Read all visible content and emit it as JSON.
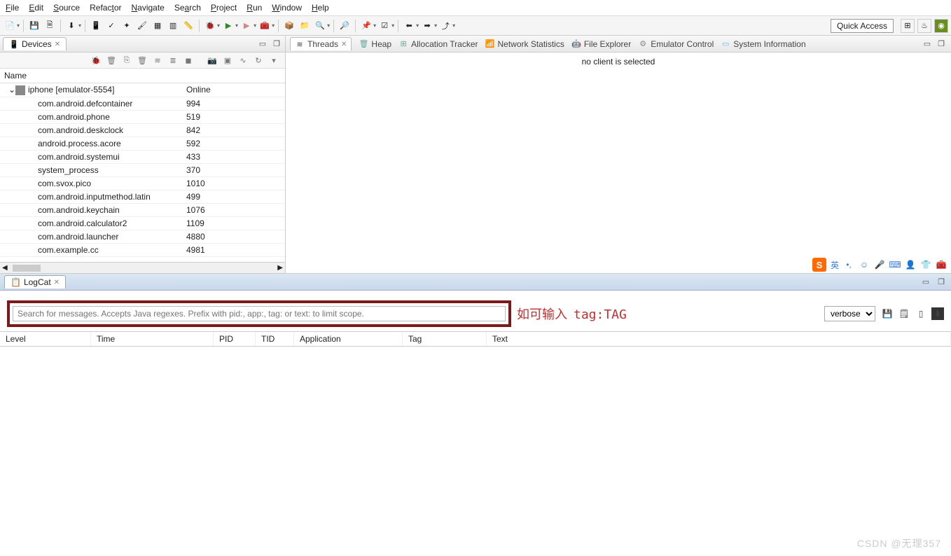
{
  "menu": {
    "file": "File",
    "edit": "Edit",
    "source": "Source",
    "refactor": "Refactor",
    "navigate": "Navigate",
    "search": "Search",
    "project": "Project",
    "run": "Run",
    "window": "Window",
    "help": "Help"
  },
  "quick_access": "Quick Access",
  "devices": {
    "title": "Devices",
    "col_name": "Name",
    "device_label": "iphone [emulator-5554]",
    "device_status": "Online",
    "processes": [
      {
        "name": "com.android.defcontainer",
        "pid": "994"
      },
      {
        "name": "com.android.phone",
        "pid": "519"
      },
      {
        "name": "com.android.deskclock",
        "pid": "842"
      },
      {
        "name": "android.process.acore",
        "pid": "592"
      },
      {
        "name": "com.android.systemui",
        "pid": "433"
      },
      {
        "name": "system_process",
        "pid": "370"
      },
      {
        "name": "com.svox.pico",
        "pid": "1010"
      },
      {
        "name": "com.android.inputmethod.latin",
        "pid": "499"
      },
      {
        "name": "com.android.keychain",
        "pid": "1076"
      },
      {
        "name": "com.android.calculator2",
        "pid": "1109"
      },
      {
        "name": "com.android.launcher",
        "pid": "4880"
      },
      {
        "name": "com.example.cc",
        "pid": "4981"
      }
    ]
  },
  "threads": {
    "tabs": {
      "threads": "Threads",
      "heap": "Heap",
      "alloc": "Allocation Tracker",
      "net": "Network Statistics",
      "file": "File Explorer",
      "emu": "Emulator Control",
      "sys": "System Information"
    },
    "no_client": "no client is selected"
  },
  "ime": {
    "lang": "英"
  },
  "logcat": {
    "title": "LogCat",
    "search_placeholder": "Search for messages. Accepts Java regexes. Prefix with pid:, app:, tag: or text: to limit scope.",
    "annotation_prefix": "如可输入",
    "annotation_tag": "tag:TAG",
    "level": "verbose",
    "cols": {
      "level": "Level",
      "time": "Time",
      "pid": "PID",
      "tid": "TID",
      "app": "Application",
      "tag": "Tag",
      "text": "Text"
    }
  },
  "watermark": "CSDN @无理357"
}
